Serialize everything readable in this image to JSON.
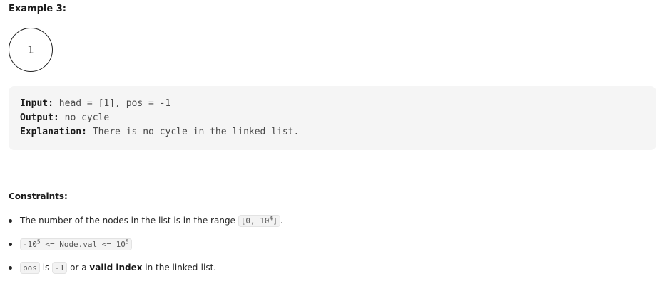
{
  "example": {
    "heading": "Example 3:",
    "node_value": "1",
    "input_label": "Input:",
    "input_value": " head = [1], pos = -1",
    "output_label": "Output:",
    "output_value": " no cycle",
    "explanation_label": "Explanation:",
    "explanation_value": " There is no cycle in the linked list."
  },
  "constraints": {
    "heading": "Constraints:",
    "item1": {
      "text_before": "The number of the nodes in the list is in the range ",
      "code_prefix": "[0, 10",
      "code_exp": "4",
      "code_suffix": "]",
      "text_after": "."
    },
    "item2": {
      "code_a": "-10",
      "code_a_exp": "5",
      "code_b": " <= Node.val <= 10",
      "code_b_exp": "5"
    },
    "item3": {
      "code_pos": "pos",
      "text_is": " is ",
      "code_neg": "-1",
      "text_or": " or a ",
      "bold_text": "valid index",
      "text_end": " in the linked-list."
    }
  }
}
